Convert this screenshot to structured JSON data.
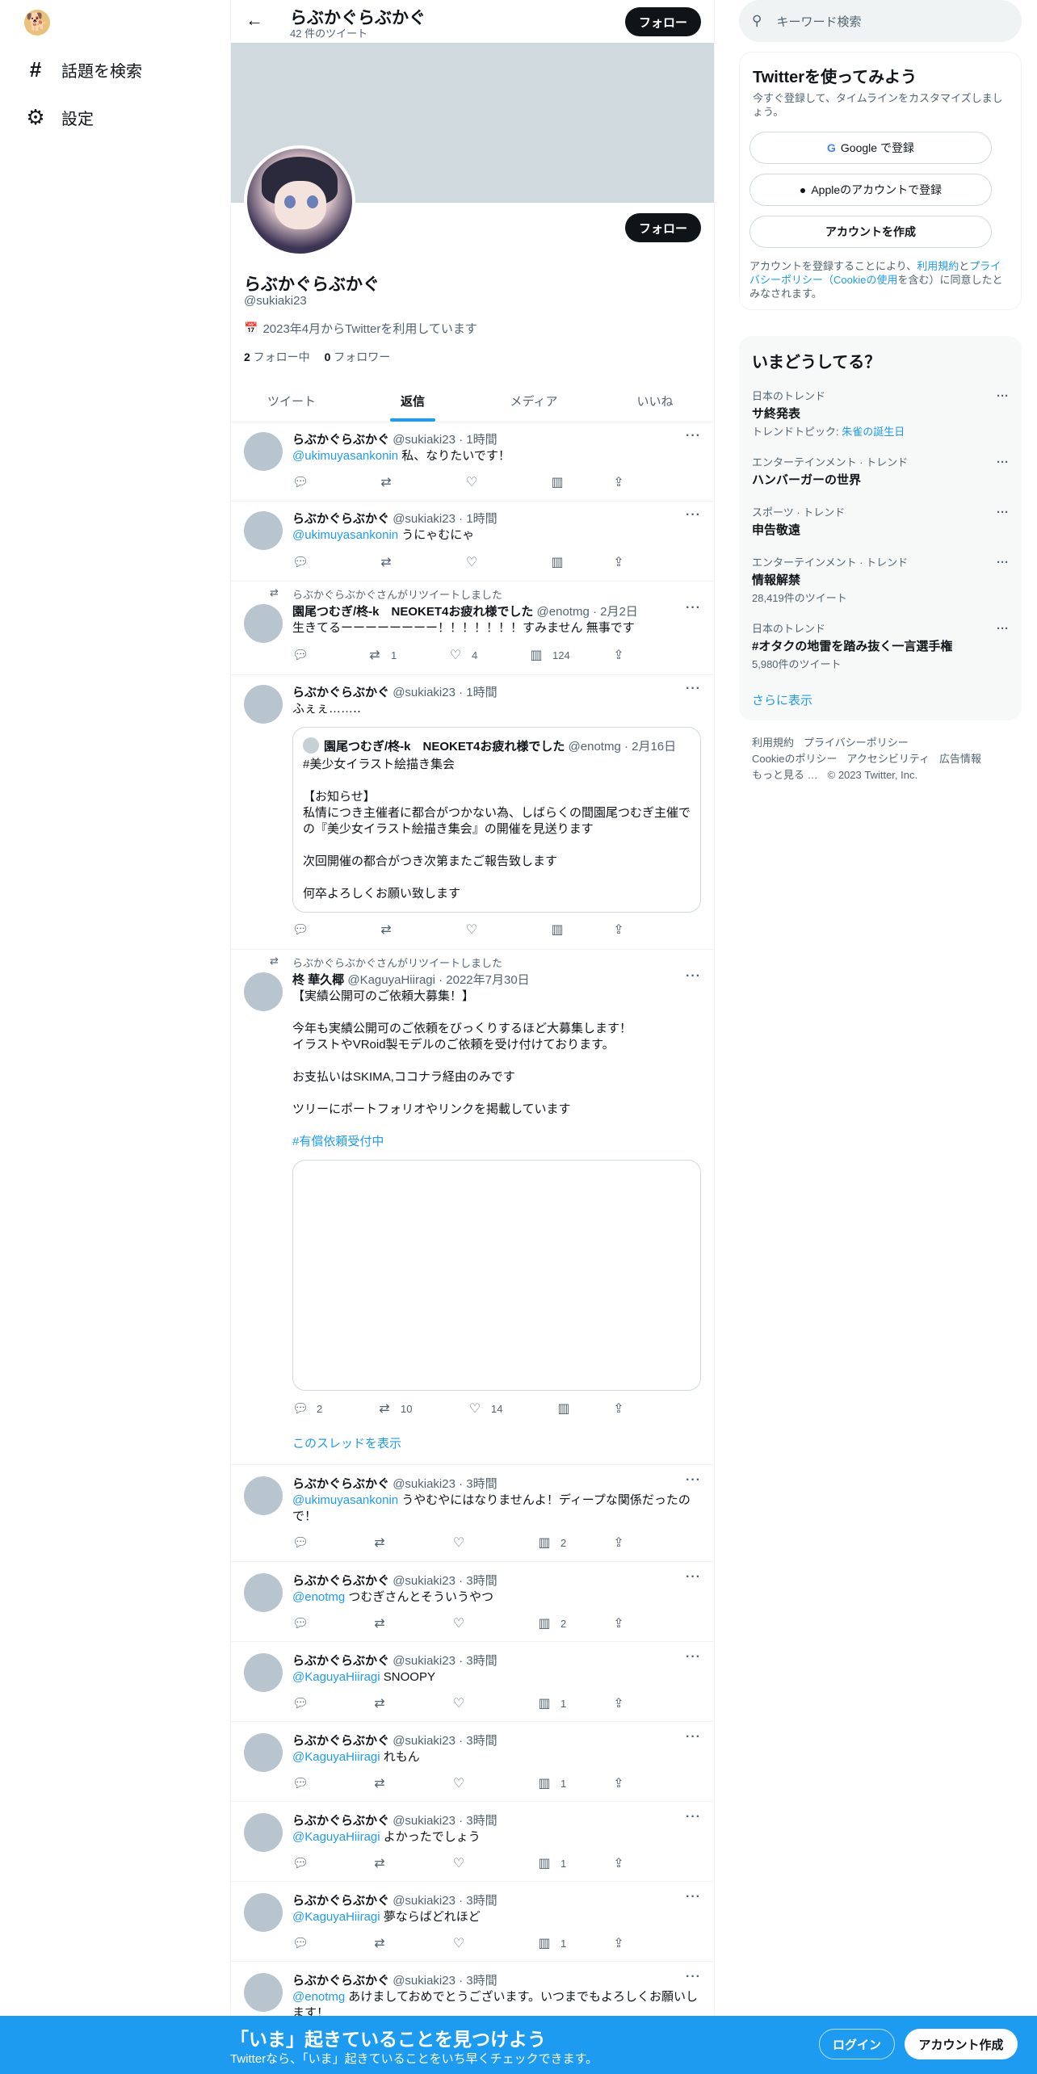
{
  "nav": {
    "logo_icon": "doge-logo-icon",
    "items": [
      {
        "icon": "hash-icon",
        "label": "話題を検索"
      },
      {
        "icon": "gear-icon",
        "label": "設定"
      }
    ]
  },
  "header": {
    "name": "らぶかぐらぶかぐ",
    "tweet_count": "42 件のツイート",
    "follow": "フォロー"
  },
  "profile": {
    "name": "らぶかぐらぶかぐ",
    "handle": "@sukiaki23",
    "joined": "2023年4月からTwitterを利用しています",
    "following_count": "2",
    "following_label": " フォロー中",
    "followers_count": "0",
    "followers_label": " フォロワー",
    "follow": "フォロー"
  },
  "tabs": [
    "ツイート",
    "返信",
    "メディア",
    "いいね"
  ],
  "active_tab": "返信",
  "tweets": [
    {
      "name": "らぶかぐらぶかぐ",
      "meta": "@sukiaki23 · 1時間",
      "mention": "@ukimuyasankonin",
      "text": " 私、なりたいです！",
      "stats": {
        "reply": "",
        "retweet": "",
        "like": "",
        "views": ""
      }
    },
    {
      "name": "らぶかぐらぶかぐ",
      "meta": "@sukiaki23 · 1時間",
      "mention": "@ukimuyasankonin",
      "text": " うにゃむにゃ",
      "stats": {
        "reply": "",
        "retweet": "",
        "like": "",
        "views": ""
      }
    },
    {
      "retweeted_by": "らぶかぐらぶかぐさんがリツイートしました",
      "name": "園尾つむぎ/柊-k　NEOKET4お疲れ様でした",
      "meta": "@enotmg · 2月2日",
      "text": "生きてるーーーーーーーー！！！！！！！すみません 無事です",
      "stats": {
        "reply": "",
        "retweet": "1",
        "like": "4",
        "views": "124"
      }
    },
    {
      "name": "らぶかぐらぶかぐ",
      "meta": "@sukiaki23 · 1時間",
      "text": "ふぇぇ……‥",
      "quote": {
        "name": "園尾つむぎ/柊-k　NEOKET4お疲れ様でした",
        "meta": "@enotmg · 2月16日",
        "lines": [
          "#美少女イラスト絵描き集会",
          "",
          "【お知らせ】",
          "私情につき主催者に都合がつかない為、しばらくの間園尾つむぎ主催での『美少女イラスト絵描き集会』の開催を見送ります",
          "",
          "次回開催の都合がつき次第またご報告致します",
          "",
          "何卒よろしくお願い致します"
        ]
      },
      "stats": {
        "reply": "",
        "retweet": "",
        "like": "",
        "views": ""
      }
    },
    {
      "retweeted_by": "らぶかぐらぶかぐさんがリツイートしました",
      "name": "柊 華久椰",
      "meta": "@KaguyaHiiragi · 2022年7月30日",
      "lines": [
        "【実績公開可のご依頼大募集！】",
        "",
        "今年も実績公開可のご依頼をびっくりするほど大募集します！",
        "イラストやVRoid製モデルのご依頼を受け付けております。",
        "",
        "お支払いはSKIMA,ココナラ経由のみです",
        "",
        "ツリーにポートフォリオやリンクを掲載しています",
        ""
      ],
      "hashtag": "#有償依頼受付中",
      "show_thread": "このスレッドを表示",
      "stats": {
        "reply": "2",
        "retweet": "10",
        "like": "14",
        "views": ""
      }
    },
    {
      "name": "らぶかぐらぶかぐ",
      "meta": "@sukiaki23 · 3時間",
      "mention": "@ukimuyasankonin",
      "text": " うやむやにはなりませんよ！ディープな関係だったので！",
      "stats": {
        "reply": "",
        "retweet": "",
        "like": "",
        "views": "2"
      }
    },
    {
      "name": "らぶかぐらぶかぐ",
      "meta": "@sukiaki23 · 3時間",
      "mention": "@enotmg",
      "text": " つむぎさんとそういうやつ",
      "stats": {
        "reply": "",
        "retweet": "",
        "like": "",
        "views": "2"
      }
    },
    {
      "name": "らぶかぐらぶかぐ",
      "meta": "@sukiaki23 · 3時間",
      "mention": "@KaguyaHiiragi",
      "text": " SNOOPY",
      "stats": {
        "reply": "",
        "retweet": "",
        "like": "",
        "views": "1"
      }
    },
    {
      "name": "らぶかぐらぶかぐ",
      "meta": "@sukiaki23 · 3時間",
      "mention": "@KaguyaHiiragi",
      "text": " れもん",
      "stats": {
        "reply": "",
        "retweet": "",
        "like": "",
        "views": "1"
      }
    },
    {
      "name": "らぶかぐらぶかぐ",
      "meta": "@sukiaki23 · 3時間",
      "mention": "@KaguyaHiiragi",
      "text": " よかったでしょう",
      "stats": {
        "reply": "",
        "retweet": "",
        "like": "",
        "views": "1"
      }
    },
    {
      "name": "らぶかぐらぶかぐ",
      "meta": "@sukiaki23 · 3時間",
      "mention": "@KaguyaHiiragi",
      "text": " 夢ならばどれほど",
      "stats": {
        "reply": "",
        "retweet": "",
        "like": "",
        "views": "1"
      }
    },
    {
      "name": "らぶかぐらぶかぐ",
      "meta": "@sukiaki23 · 3時間",
      "mention": "@enotmg",
      "text": " あけましておめでとうございます。いつまでもよろしくお願いします！",
      "stats": {
        "reply": "",
        "retweet": "",
        "like": "",
        "views": ""
      }
    }
  ],
  "search": {
    "placeholder": "キーワード検索"
  },
  "signup": {
    "title": "Twitterを使ってみよう",
    "subtitle": "今すぐ登録して、タイムラインをカスタマイズしましょう。",
    "google": "Google で登録",
    "apple": "Appleのアカウントで登録",
    "create": "アカウントを作成",
    "legal_1": "アカウントを登録することにより、",
    "legal_link1": "利用規約",
    "legal_2": "と",
    "legal_link2": "プライバシーポリシー（Cookieの使用",
    "legal_3": "を含む）に同意したとみなされます。"
  },
  "trends": {
    "title": "いまどうしてる？",
    "items": [
      {
        "category": "日本のトレンド",
        "name": "サ終発表",
        "extra_prefix": "トレンドトピック: ",
        "extra_link": "朱雀の誕生日"
      },
      {
        "category": "エンターテインメント · トレンド",
        "name": "ハンバーガーの世界",
        "extra_prefix": "",
        "extra_link": ""
      },
      {
        "category": "スポーツ · トレンド",
        "name": "申告敬遠",
        "extra_prefix": "",
        "extra_link": ""
      },
      {
        "category": "エンターテインメント · トレンド",
        "name": "情報解禁",
        "extra_prefix": "28,419件のツイート",
        "extra_link": ""
      },
      {
        "category": "日本のトレンド",
        "name": "#オタクの地雷を踏み抜く一言選手権",
        "extra_prefix": "5,980件のツイート",
        "extra_link": ""
      }
    ],
    "show_more": "さらに表示"
  },
  "footer": {
    "links_row1": [
      "利用規約",
      "プライバシーポリシー"
    ],
    "links_row2": [
      "Cookieのポリシー",
      "アクセシビリティ",
      "広告情報"
    ],
    "more": "もっと見る …",
    "copyright": "© 2023 Twitter, Inc."
  },
  "bottom_bar": {
    "title": "「いま」起きていることを見つけよう",
    "subtitle": "Twitterなら、「いま」起きていることをいち早くチェックできます。",
    "login": "ログイン",
    "signup": "アカウント作成"
  }
}
